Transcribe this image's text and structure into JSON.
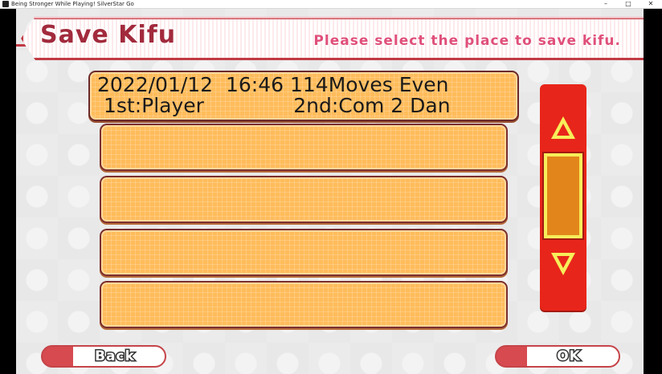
{
  "window": {
    "title": "Being Stronger While Playing! SilverStar Go",
    "minimize_glyph": "–",
    "maximize_glyph": "□",
    "close_glyph": "✕"
  },
  "header": {
    "title": "Save Kifu",
    "subtitle": "Please select the place to save kifu."
  },
  "slots": [
    {
      "line1": "2022/01/12  16:46 114Moves Even",
      "line2": "1st:Player              2nd:Com 2 Dan",
      "selected": true
    },
    {
      "line1": "",
      "line2": "",
      "selected": false
    },
    {
      "line1": "",
      "line2": "",
      "selected": false
    },
    {
      "line1": "",
      "line2": "",
      "selected": false
    },
    {
      "line1": "",
      "line2": "",
      "selected": false
    }
  ],
  "scroll": {
    "up_icon": "triangle-up-icon",
    "down_icon": "triangle-down-icon"
  },
  "buttons": {
    "back_label": "Back",
    "ok_label": "OK"
  },
  "colors": {
    "accent_red": "#e8251a",
    "banner_red": "#c23a44",
    "slot_orange": "#ffbc5b",
    "thumb_orange": "#e2861b",
    "thumb_border": "#f7ee5a",
    "title_pink": "#e04f7a"
  }
}
